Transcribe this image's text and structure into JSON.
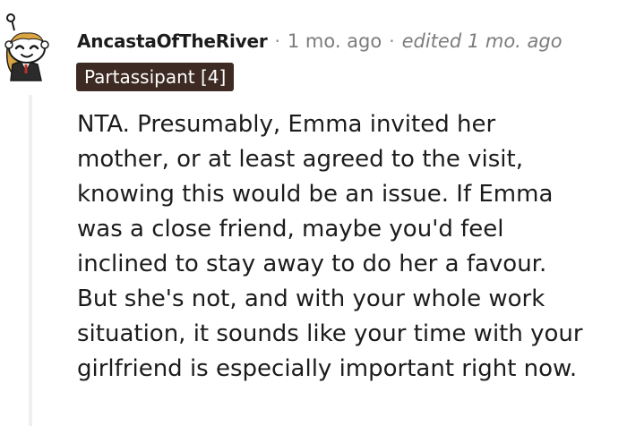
{
  "comment": {
    "author": "AncastaOfTheRiver",
    "separator": "·",
    "time": "1 mo. ago",
    "edited": "edited 1 mo. ago",
    "flair": "Partassipant [4]",
    "body_lines": [
      "NTA. Presumably, Emma invited her",
      "mother, or at least agreed to the visit,",
      "knowing this would be an issue. If Emma",
      "was a close friend, maybe you'd feel",
      "inclined to stay away to do her a favour.",
      "But she's not, and with your whole work",
      "situation, it sounds like your time with your",
      "girlfriend is especially important right now."
    ]
  },
  "colors": {
    "flair_background": "#3d2b23",
    "thread_line": "#edeff1",
    "meta_text": "#7c7c7c"
  },
  "icons": {
    "avatar": "snoo-avatar-icon"
  }
}
